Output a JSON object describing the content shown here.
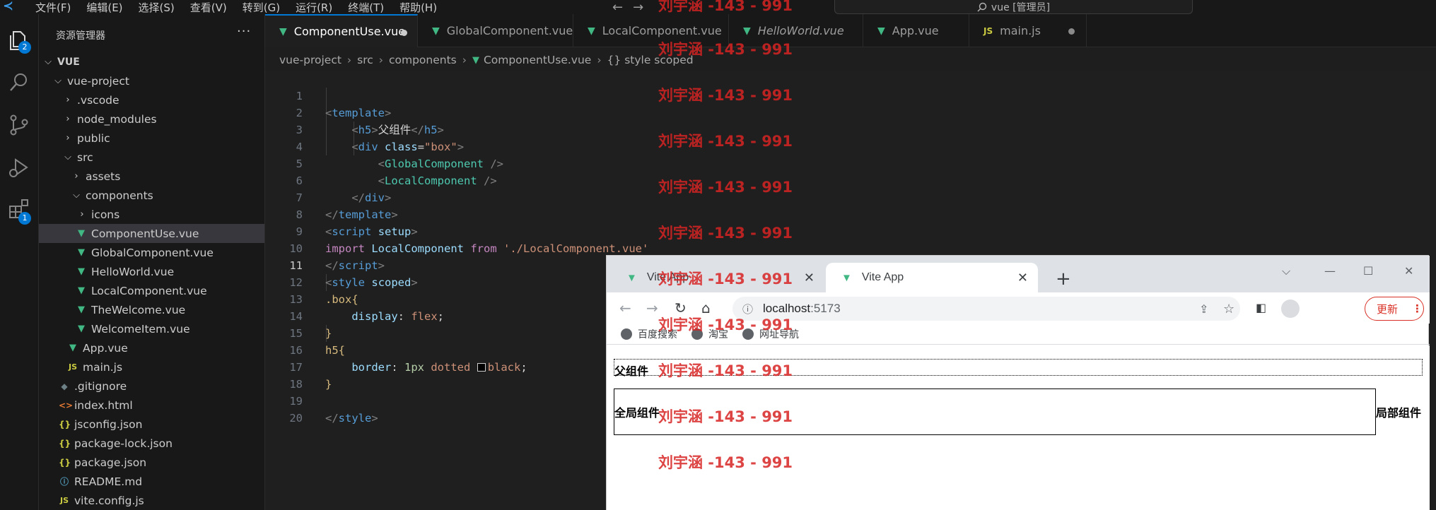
{
  "menubar": {
    "items": [
      "文件(F)",
      "编辑(E)",
      "选择(S)",
      "查看(V)",
      "转到(G)",
      "运行(R)",
      "终端(T)",
      "帮助(H)"
    ],
    "command_center": "vue [管理员]"
  },
  "activity": {
    "explorer_badge": "2",
    "extensions_badge": "1"
  },
  "sidebar": {
    "title": "资源管理器",
    "more": "···",
    "root": "VUE",
    "tree": [
      {
        "label": "vue-project",
        "type": "folder-open"
      },
      {
        "label": ".vscode",
        "type": "folder"
      },
      {
        "label": "node_modules",
        "type": "folder"
      },
      {
        "label": "public",
        "type": "folder"
      },
      {
        "label": "src",
        "type": "folder-open"
      },
      {
        "label": "assets",
        "type": "folder"
      },
      {
        "label": "components",
        "type": "folder-open"
      },
      {
        "label": "icons",
        "type": "folder"
      },
      {
        "label": "ComponentUse.vue",
        "type": "vue"
      },
      {
        "label": "GlobalComponent.vue",
        "type": "vue"
      },
      {
        "label": "HelloWorld.vue",
        "type": "vue"
      },
      {
        "label": "LocalComponent.vue",
        "type": "vue"
      },
      {
        "label": "TheWelcome.vue",
        "type": "vue"
      },
      {
        "label": "WelcomeItem.vue",
        "type": "vue"
      },
      {
        "label": "App.vue",
        "type": "vue"
      },
      {
        "label": "main.js",
        "type": "js"
      },
      {
        "label": ".gitignore",
        "type": "git"
      },
      {
        "label": "index.html",
        "type": "html"
      },
      {
        "label": "jsconfig.json",
        "type": "json"
      },
      {
        "label": "package-lock.json",
        "type": "json"
      },
      {
        "label": "package.json",
        "type": "json"
      },
      {
        "label": "README.md",
        "type": "info"
      },
      {
        "label": "vite.config.js",
        "type": "js"
      }
    ]
  },
  "tabs": [
    {
      "label": "ComponentUse.vue"
    },
    {
      "label": "GlobalComponent.vue"
    },
    {
      "label": "LocalComponent.vue"
    },
    {
      "label": "HelloWorld.vue"
    },
    {
      "label": "App.vue"
    },
    {
      "label": "main.js"
    }
  ],
  "breadcrumb": [
    "vue-project",
    "src",
    "components",
    "ComponentUse.vue",
    "{} style scoped"
  ],
  "code": {
    "line_numbers": [
      "1",
      "2",
      "3",
      "4",
      "5",
      "6",
      "7",
      "8",
      "9",
      "10",
      "11",
      "12",
      "13",
      "14",
      "15",
      "16",
      "17",
      "18",
      "19",
      "20"
    ],
    "l2_text": "父组件",
    "l3_attr": "class",
    "l3_val": "\"box\"",
    "l4_comp": "GlobalComponent",
    "l5_comp": "LocalComponent",
    "l9_import": "import",
    "l9_name": "LocalComponent",
    "l9_from": "from",
    "l9_path": "'./LocalComponent.vue'",
    "l12_sel": ".box",
    "l13_prop": "display",
    "l13_val": "flex",
    "l15_sel": "h5",
    "l16_prop": "border",
    "l16_num": "1px",
    "l16_style": "dotted",
    "l16_color": "black"
  },
  "browser": {
    "tabs": [
      "Vite App",
      "Vite App"
    ],
    "url_host": "localhost",
    "url_port": ":5173",
    "update_label": "更新",
    "bookmarks": [
      "百度搜索",
      "淘宝",
      "网址导航"
    ],
    "page": {
      "h5": "父组件",
      "global_component": "全局组件",
      "local_component": "局部组件"
    }
  },
  "watermark": "刘宇涵 -143 - 991"
}
